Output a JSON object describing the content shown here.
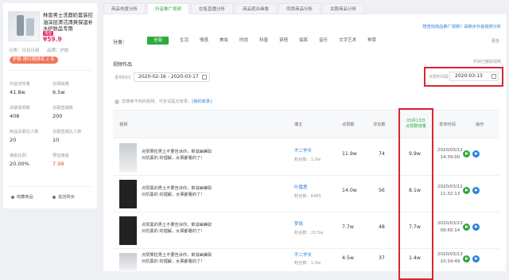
{
  "product": {
    "title": "林恩男士洗面奶套装控油深层清洁清爽保湿补水护肤品专用",
    "price_tag": "淘宝",
    "price": "¥59.9",
    "meta_left": "分类：日化日用",
    "meta_right": "品牌：护肤",
    "rank_badge": "护肤 排行榜排名 2 名",
    "stats": [
      {
        "label": "抖音浏览量",
        "value": "41.8w"
      },
      {
        "label": "全网销量",
        "value": "6.5w"
      },
      {
        "label": "关联视频数",
        "value": "408"
      },
      {
        "label": "关联直播数",
        "value": "200"
      },
      {
        "label": "商品关联达人数",
        "value": "20"
      },
      {
        "label": "关联直播达人数",
        "value": "10"
      },
      {
        "label": "佣金比例",
        "value": "20.00%"
      },
      {
        "label": "预估佣金",
        "value": "7.98"
      }
    ],
    "btn_collect": "收藏商品",
    "btn_shop": "进店购买"
  },
  "tabs": [
    "商品热度分析",
    "抖音推广视频",
    "在售直播分析",
    "商品观众画像",
    "同类商品分析",
    "关联商品分析"
  ],
  "active_tab": 1,
  "help_link": "想查找商品推广视频？请移步抖音视频分析",
  "categories": {
    "label": "分类：",
    "items": [
      "全部",
      "生活",
      "情感",
      "美妆",
      "时尚",
      "科普",
      "穿搭",
      "搞笑",
      "音乐",
      "文字艺术",
      "种草"
    ],
    "more": "更多"
  },
  "section": {
    "title": "视频作品",
    "checkbox_text": "开启已删除视频",
    "date_label": "发布时间",
    "date_range": "2020-02-16 - 2020-03-17",
    "date2_label": "点赞时间段",
    "date2_value": "2020-03-13",
    "tip_text": "您搜索不到的视频，可尝试提交收录，",
    "tip_link": "[我的收录]"
  },
  "table": {
    "headers": {
      "video": "视频",
      "author": "博主",
      "likes": "点赞数",
      "comments": "评论数",
      "daily_top": "03月13日",
      "daily_bottom": "点赞数增量",
      "pub": "发布时间",
      "op": "操作"
    },
    "rows": [
      {
        "caption": "点赞果粒男土不要告诉你，菜滋幽兼取对抗黑的 的理解，女票都看的了！",
        "author": "不二学长",
        "fans": "粉丝数：1.0w",
        "likes": "11.9w",
        "comments": "74",
        "daily": "9.9w",
        "pub_date": "2020/03/12",
        "pub_time": "14:39:00"
      },
      {
        "caption": "点赞黑的男土不要告诉你，菜滋幽兼取对抗黑的 的理解，女票都看的了！",
        "author": "叶嘉惠",
        "fans": "粉丝数：6465",
        "likes": "14.0w",
        "comments": "56",
        "daily": "8.1w",
        "pub_date": "2020/03/12",
        "pub_time": "11:32:13"
      },
      {
        "caption": "点赞黑的男土不要告诉你，菜滋幽兼取对抗黑的 的理解，女票都看的了！",
        "author": "梦瑶",
        "fans": "粉丝数：23.5w",
        "likes": "7.7w",
        "comments": "48",
        "daily": "7.7w",
        "pub_date": "2020/03/13",
        "pub_time": "09:50:14"
      },
      {
        "caption": "点赞果粒男土不要告诉你，菜滋幽兼取对抗黑的 的理解，女票都看的了！",
        "author": "不二学长",
        "fans": "粉丝数：1.0w",
        "likes": "4.5w",
        "comments": "37",
        "daily": "1.4w",
        "pub_date": "2020/03/13",
        "pub_time": "10:34:49"
      }
    ]
  }
}
